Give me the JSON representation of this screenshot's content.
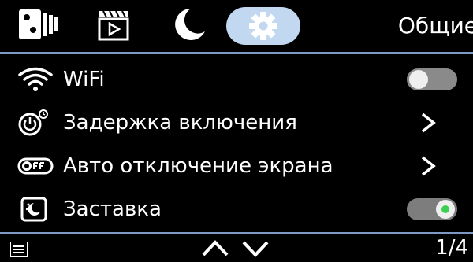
{
  "header": {
    "section_title": "Общие",
    "tabs": [
      {
        "icon": "gallery-icon"
      },
      {
        "icon": "video-icon"
      },
      {
        "icon": "night-mode-icon"
      },
      {
        "icon": "settings-gear-icon",
        "active": true
      }
    ]
  },
  "menu": {
    "items": [
      {
        "label": "WiFi",
        "icon": "wifi-icon",
        "control": "toggle",
        "state": "off"
      },
      {
        "label": "Задержка включения",
        "icon": "power-delay-icon",
        "control": "chevron"
      },
      {
        "label": "Авто отключение экрана",
        "icon": "screen-off-icon",
        "control": "chevron"
      },
      {
        "label": "Заставка",
        "icon": "screensaver-icon",
        "control": "toggle",
        "state": "on"
      }
    ]
  },
  "footer": {
    "page_indicator": "1/4"
  },
  "colors": {
    "background": "#000000",
    "active_tab": "#c2d8f0",
    "divider": "#7e9ac4",
    "toggle_on_indicator": "#3ccf52"
  }
}
